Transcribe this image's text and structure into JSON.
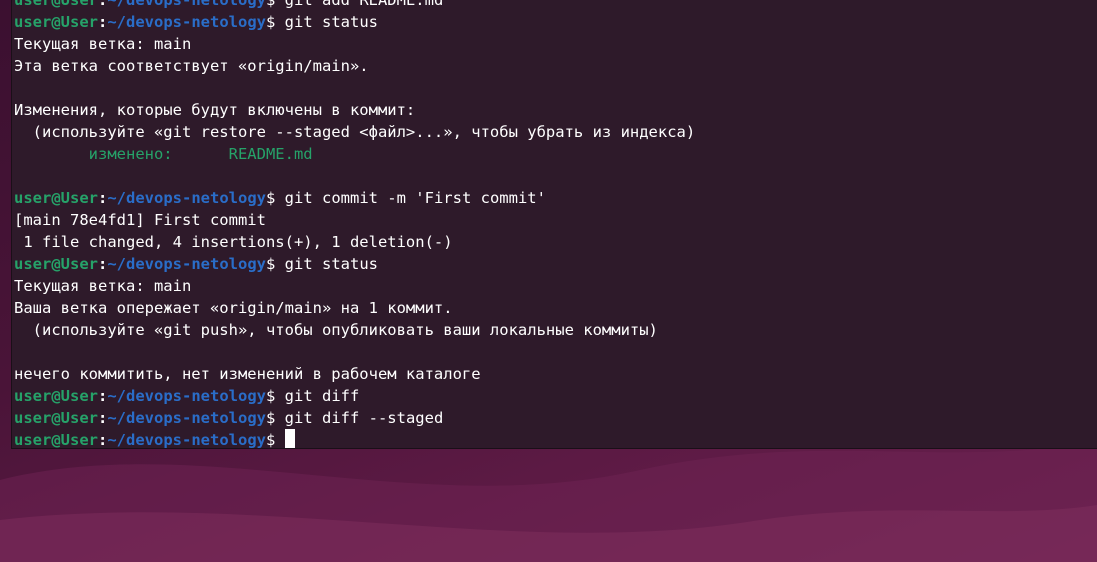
{
  "prompt": {
    "user": "user@User",
    "colon": ":",
    "path": "~/devops-netology",
    "dollar": "$"
  },
  "terminal": {
    "lines": [
      {
        "kind": "prompt",
        "cmd": " git add README.md"
      },
      {
        "kind": "prompt",
        "cmd": " git status"
      },
      {
        "kind": "text",
        "text": "Текущая ветка: main"
      },
      {
        "kind": "text",
        "text": "Эта ветка соответствует «origin/main»."
      },
      {
        "kind": "text",
        "text": ""
      },
      {
        "kind": "text",
        "text": "Изменения, которые будут включены в коммит:"
      },
      {
        "kind": "text",
        "text": "  (используйте «git restore --staged <файл>...», чтобы убрать из индекса)"
      },
      {
        "kind": "green",
        "text": "\tизменено:      README.md"
      },
      {
        "kind": "text",
        "text": ""
      },
      {
        "kind": "prompt",
        "cmd": " git commit -m 'First commit'"
      },
      {
        "kind": "text",
        "text": "[main 78e4fd1] First commit"
      },
      {
        "kind": "text",
        "text": " 1 file changed, 4 insertions(+), 1 deletion(-)"
      },
      {
        "kind": "prompt",
        "cmd": " git status"
      },
      {
        "kind": "text",
        "text": "Текущая ветка: main"
      },
      {
        "kind": "text",
        "text": "Ваша ветка опережает «origin/main» на 1 коммит."
      },
      {
        "kind": "text",
        "text": "  (используйте «git push», чтобы опубликовать ваши локальные коммиты)"
      },
      {
        "kind": "text",
        "text": ""
      },
      {
        "kind": "text",
        "text": "нечего коммитить, нет изменений в рабочем каталоге"
      },
      {
        "kind": "prompt",
        "cmd": " git diff"
      },
      {
        "kind": "prompt",
        "cmd": " git diff --staged"
      },
      {
        "kind": "prompt-active",
        "cmd": " "
      }
    ]
  },
  "colors": {
    "prompt_user": "#26a269",
    "prompt_path": "#2a6dc8",
    "terminal_bg": "#2e1a2a",
    "text": "#ffffff"
  }
}
